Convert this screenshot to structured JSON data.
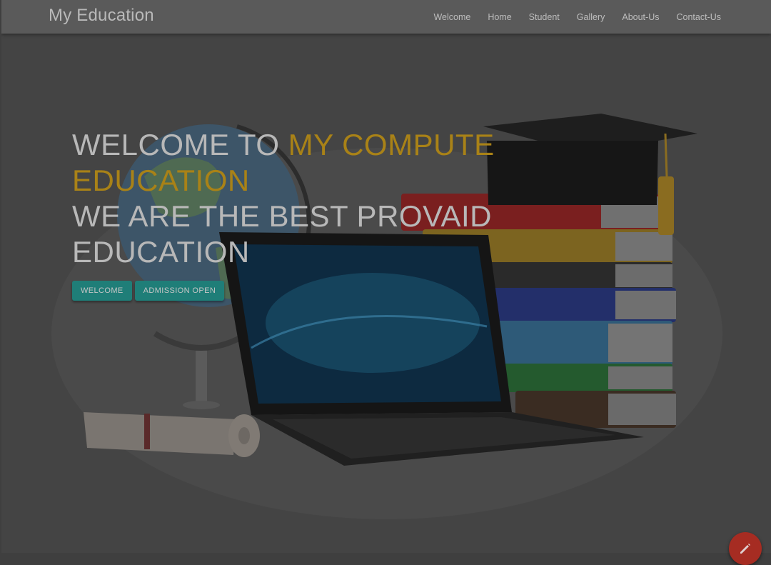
{
  "brand": "My Education",
  "nav": [
    "Welcome",
    "Home",
    "Student",
    "Gallery",
    "About-Us",
    "Contact-Us"
  ],
  "hero": {
    "line1_plain": "WELCOME TO ",
    "line1_highlight": "MY COMPUTE EDUCATION",
    "line2": "WE ARE THE BEST PROVAID EDUCATION"
  },
  "buttons": {
    "welcome": "WELCOME",
    "admission": "ADMISSION OPEN"
  },
  "fab_icon": "pencil-icon",
  "colors": {
    "highlight": "#a98217",
    "button": "#1f7e78",
    "fab": "#a62c22",
    "navbar": "#5a5a5a"
  }
}
